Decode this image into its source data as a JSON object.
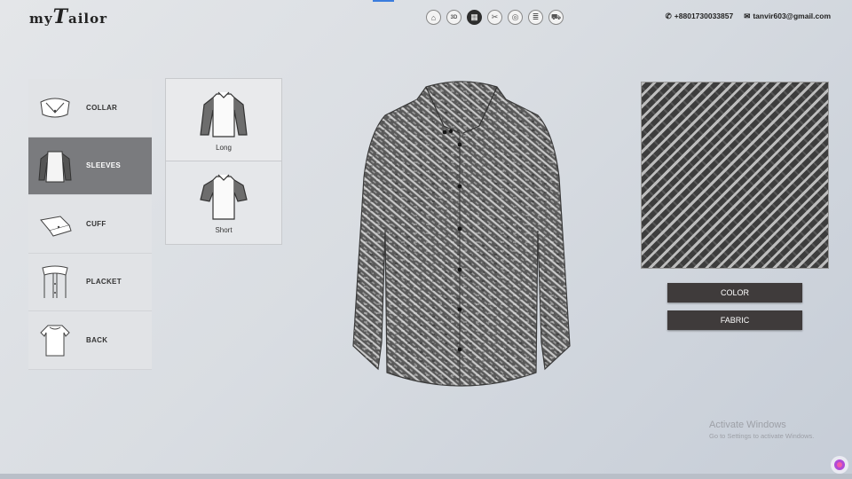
{
  "logo": {
    "prefix": "my",
    "initial": "T",
    "rest": "ailor"
  },
  "toolbar": {
    "items": [
      {
        "name": "home-icon",
        "glyph": "⌂"
      },
      {
        "name": "3d-icon",
        "glyph": "3D"
      },
      {
        "name": "fabric-icon",
        "glyph": "▦",
        "active": true
      },
      {
        "name": "style-icon",
        "glyph": "✂"
      },
      {
        "name": "buttons-icon",
        "glyph": "◎"
      },
      {
        "name": "measure-icon",
        "glyph": "≣"
      },
      {
        "name": "cart-icon",
        "glyph": "⛟"
      }
    ]
  },
  "contact": {
    "phone": "+8801730033857",
    "email": "tanvir603@gmail.com"
  },
  "menu": {
    "items": [
      {
        "label": "COLLAR"
      },
      {
        "label": "SLEEVES",
        "active": true
      },
      {
        "label": "CUFF"
      },
      {
        "label": "PLACKET"
      },
      {
        "label": "BACK"
      }
    ]
  },
  "options": {
    "items": [
      {
        "label": "Long",
        "selected": true
      },
      {
        "label": "Short"
      }
    ]
  },
  "panel": {
    "color_button": "COLOR",
    "fabric_button": "FABRIC"
  },
  "watermark": {
    "title": "Activate Windows",
    "subtitle": "Go to Settings to activate Windows."
  },
  "colors": {
    "active_menu": "#7a7b7e",
    "button_bg": "#3f3b3b",
    "accent": "#3b7ddd"
  }
}
